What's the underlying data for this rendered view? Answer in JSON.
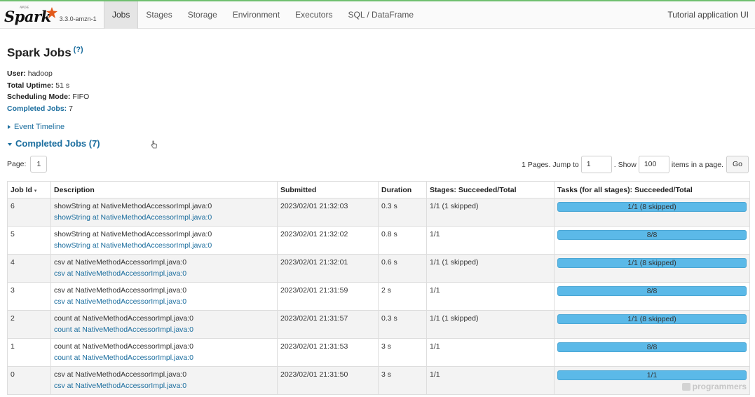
{
  "header": {
    "logo_text": "Spark",
    "logo_apache": "APACHE",
    "version": "3.3.0-amzn-1",
    "tabs": [
      {
        "label": "Jobs",
        "active": true
      },
      {
        "label": "Stages"
      },
      {
        "label": "Storage"
      },
      {
        "label": "Environment"
      },
      {
        "label": "Executors"
      },
      {
        "label": "SQL / DataFrame"
      }
    ],
    "app_name": "Tutorial application UI"
  },
  "page": {
    "title": "Spark Jobs",
    "help": "(?)"
  },
  "summary": {
    "user_label": "User:",
    "user_value": "hadoop",
    "uptime_label": "Total Uptime:",
    "uptime_value": "51 s",
    "scheduling_label": "Scheduling Mode:",
    "scheduling_value": "FIFO",
    "completed_label": "Completed Jobs:",
    "completed_value": "7"
  },
  "event_timeline": "Event Timeline",
  "completed_jobs_header": "Completed Jobs (7)",
  "pager": {
    "page_label": "Page:",
    "page_value": "1",
    "pages_text": "1 Pages. Jump to",
    "jump_value": "1",
    "show_text": ". Show",
    "show_value": "100",
    "items_text": "items in a page.",
    "go_label": "Go"
  },
  "table": {
    "headers": [
      "Job Id",
      "Description",
      "Submitted",
      "Duration",
      "Stages: Succeeded/Total",
      "Tasks (for all stages): Succeeded/Total"
    ],
    "sort_indicator": "▾",
    "rows": [
      {
        "id": "6",
        "desc1": "showString at NativeMethodAccessorImpl.java:0",
        "desc2": "showString at NativeMethodAccessorImpl.java:0",
        "submitted": "2023/02/01 21:32:03",
        "duration": "0.3 s",
        "stages": "1/1 (1 skipped)",
        "tasks": "1/1 (8 skipped)"
      },
      {
        "id": "5",
        "desc1": "showString at NativeMethodAccessorImpl.java:0",
        "desc2": "showString at NativeMethodAccessorImpl.java:0",
        "submitted": "2023/02/01 21:32:02",
        "duration": "0.8 s",
        "stages": "1/1",
        "tasks": "8/8"
      },
      {
        "id": "4",
        "desc1": "csv at NativeMethodAccessorImpl.java:0",
        "desc2": "csv at NativeMethodAccessorImpl.java:0",
        "submitted": "2023/02/01 21:32:01",
        "duration": "0.6 s",
        "stages": "1/1 (1 skipped)",
        "tasks": "1/1 (8 skipped)"
      },
      {
        "id": "3",
        "desc1": "csv at NativeMethodAccessorImpl.java:0",
        "desc2": "csv at NativeMethodAccessorImpl.java:0",
        "submitted": "2023/02/01 21:31:59",
        "duration": "2 s",
        "stages": "1/1",
        "tasks": "8/8"
      },
      {
        "id": "2",
        "desc1": "count at NativeMethodAccessorImpl.java:0",
        "desc2": "count at NativeMethodAccessorImpl.java:0",
        "submitted": "2023/02/01 21:31:57",
        "duration": "0.3 s",
        "stages": "1/1 (1 skipped)",
        "tasks": "1/1 (8 skipped)"
      },
      {
        "id": "1",
        "desc1": "count at NativeMethodAccessorImpl.java:0",
        "desc2": "count at NativeMethodAccessorImpl.java:0",
        "submitted": "2023/02/01 21:31:53",
        "duration": "3 s",
        "stages": "1/1",
        "tasks": "8/8"
      },
      {
        "id": "0",
        "desc1": "csv at NativeMethodAccessorImpl.java:0",
        "desc2": "csv at NativeMethodAccessorImpl.java:0",
        "submitted": "2023/02/01 21:31:50",
        "duration": "3 s",
        "stages": "1/1",
        "tasks": "1/1"
      }
    ]
  },
  "watermark": "programmers",
  "colors": {
    "link": "#1a6d9e",
    "progress": "#5bb9e8",
    "topbar_accent": "#6fbf6f"
  }
}
